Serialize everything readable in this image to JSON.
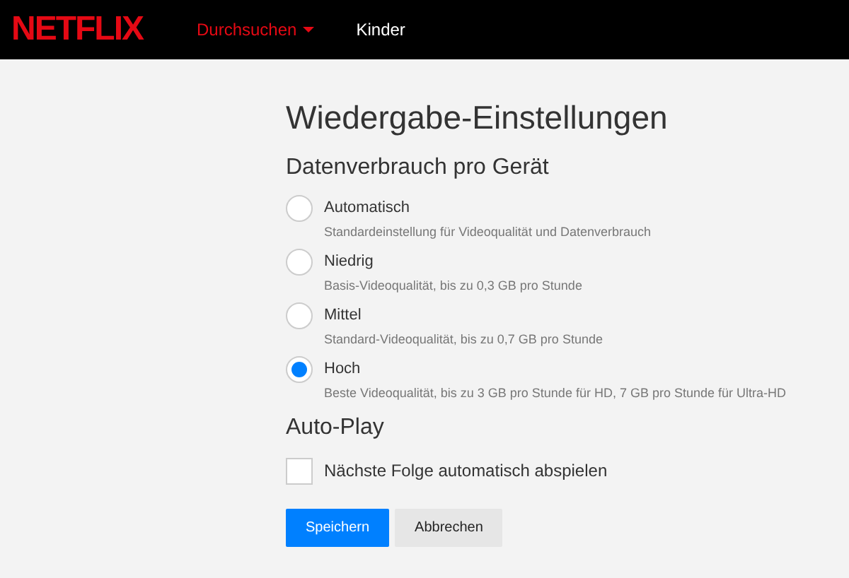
{
  "header": {
    "logo": "NETFLIX",
    "nav": [
      {
        "label": "Durchsuchen",
        "selected": true,
        "dropdown": true
      },
      {
        "label": "Kinder",
        "selected": false,
        "dropdown": false
      }
    ]
  },
  "title": "Wiedergabe-Einstellungen",
  "data_usage": {
    "heading": "Datenverbrauch pro Gerät",
    "options": [
      {
        "label": "Automatisch",
        "description": "Standardeinstellung für Videoqualität und Datenverbrauch",
        "selected": false
      },
      {
        "label": "Niedrig",
        "description": "Basis-Videoqualität, bis zu 0,3 GB pro Stunde",
        "selected": false
      },
      {
        "label": "Mittel",
        "description": "Standard-Videoqualität, bis zu 0,7 GB pro Stunde",
        "selected": false
      },
      {
        "label": "Hoch",
        "description": "Beste Videoqualität, bis zu 3 GB pro Stunde für HD, 7 GB pro Stunde für Ultra-HD",
        "selected": true
      }
    ]
  },
  "autoplay": {
    "heading": "Auto-Play",
    "option": {
      "label": "Nächste Folge automatisch abspielen",
      "checked": false
    }
  },
  "buttons": [
    {
      "label": "Speichern",
      "kind": "primary"
    },
    {
      "label": "Abbrechen",
      "kind": "secondary"
    }
  ]
}
